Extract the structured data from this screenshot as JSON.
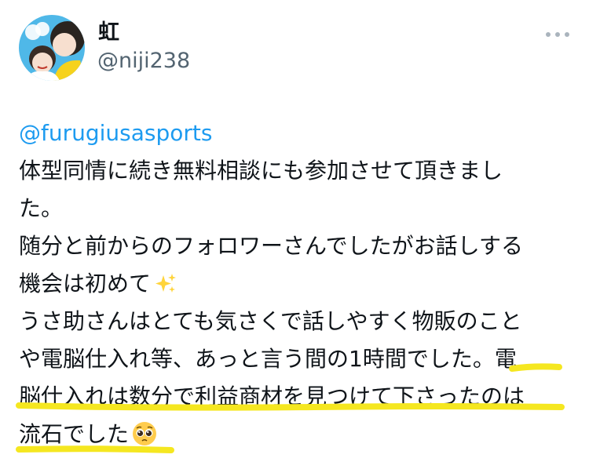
{
  "user": {
    "display_name": "虹",
    "handle": "@niji238"
  },
  "menu": {
    "icon": "more-horizontal-icon"
  },
  "tweet": {
    "mention": "@furugiusasports",
    "lines": [
      "体型同情に続き無料相談にも参加させて頂きまし",
      "た。",
      "随分と前からのフォロワーさんでしたがお話しする",
      "機会は初めて",
      "うさ助さんはとても気さくで話しやすく物販のこと",
      "や電脳仕入れ等、あっと言う間の1時間でした。電",
      "脳仕入れは数分で利益商材を見つけて下さったのは",
      "流石でした"
    ],
    "emojis": [
      "sparkles-icon",
      "pleading-face-icon"
    ]
  },
  "colors": {
    "mention": "#1d9bf0",
    "handle": "#536471",
    "highlight": "#f5e720"
  }
}
